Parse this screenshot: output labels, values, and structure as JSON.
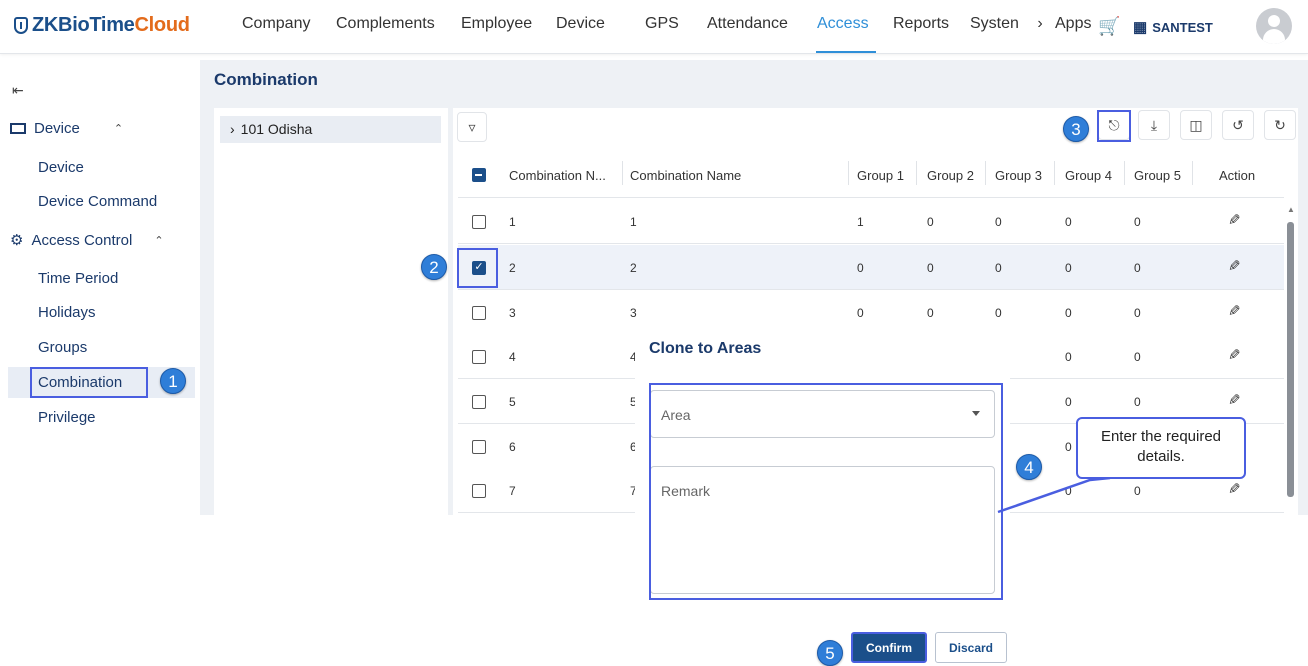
{
  "brand": {
    "name_a": "ZKBioTime",
    "name_b": "Cloud"
  },
  "nav": {
    "items": [
      "Company",
      "Complements",
      "Employee",
      "Device",
      "GPS",
      "Attendance",
      "Access",
      "Reports",
      "Systen",
      "›",
      "Apps"
    ],
    "active": "Access",
    "company": "SANTEST"
  },
  "sidebar": {
    "groups": [
      {
        "label": "Device",
        "items": [
          "Device",
          "Device Command"
        ]
      },
      {
        "label": "Access Control",
        "items": [
          "Time Period",
          "Holidays",
          "Groups",
          "Combination",
          "Privilege"
        ]
      }
    ],
    "selected": "Combination"
  },
  "page": {
    "title": "Combination"
  },
  "tree": {
    "node": "101 Odisha"
  },
  "table": {
    "columns": [
      "Combination N...",
      "Combination Name",
      "Group 1",
      "Group 2",
      "Group 3",
      "Group 4",
      "Group 5",
      "Action"
    ],
    "rows": [
      [
        "1",
        "1",
        "1",
        "0",
        "0",
        "0",
        "0"
      ],
      [
        "2",
        "2",
        "0",
        "0",
        "0",
        "0",
        "0"
      ],
      [
        "3",
        "3",
        "0",
        "0",
        "0",
        "0",
        "0"
      ],
      [
        "4",
        "4",
        "",
        "",
        "",
        "0",
        "0"
      ],
      [
        "5",
        "5",
        "",
        "",
        "",
        "0",
        "0"
      ],
      [
        "6",
        "6",
        "",
        "",
        "",
        "0",
        ""
      ],
      [
        "7",
        "7",
        "",
        "",
        "",
        "0",
        "0"
      ]
    ],
    "selected_row": 2
  },
  "dialog": {
    "title": "Clone to Areas",
    "area_placeholder": "Area",
    "remark_placeholder": "Remark",
    "confirm": "Confirm",
    "discard": "Discard"
  },
  "callout": {
    "text": "Enter the required details."
  },
  "steps": [
    "1",
    "2",
    "3",
    "4",
    "5"
  ],
  "colors": {
    "brand_blue": "#1b4f8a",
    "accent": "#2f8fd8",
    "brand_orange": "#e36b1b",
    "annotation": "#4a5ee0"
  }
}
